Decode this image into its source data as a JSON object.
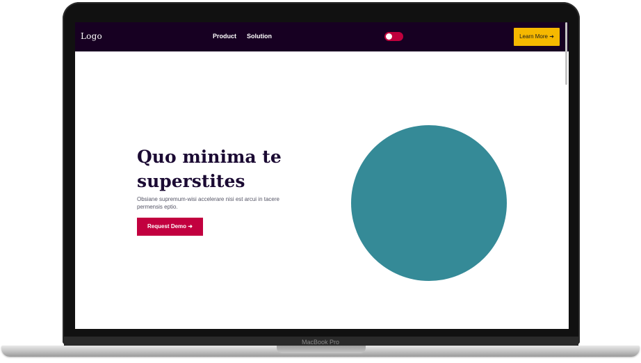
{
  "device": {
    "label": "MacBook Pro"
  },
  "navbar": {
    "logo": "Logo",
    "links": [
      "Product",
      "Solution"
    ],
    "theme_toggle": "toggle-icon",
    "cta_label": "Learn More ➜"
  },
  "hero": {
    "title": "Quo minima te superstites",
    "description": "Obsiane supremum-wisi accelerare nisi est arcui in tacere permensis eptio.",
    "cta_label": "Request Demo ➜"
  },
  "colors": {
    "navbar_bg": "#170022",
    "accent_yellow": "#f6b800",
    "accent_red": "#c2003f",
    "circle_teal": "#358a97",
    "title_color": "#1b0a33"
  }
}
